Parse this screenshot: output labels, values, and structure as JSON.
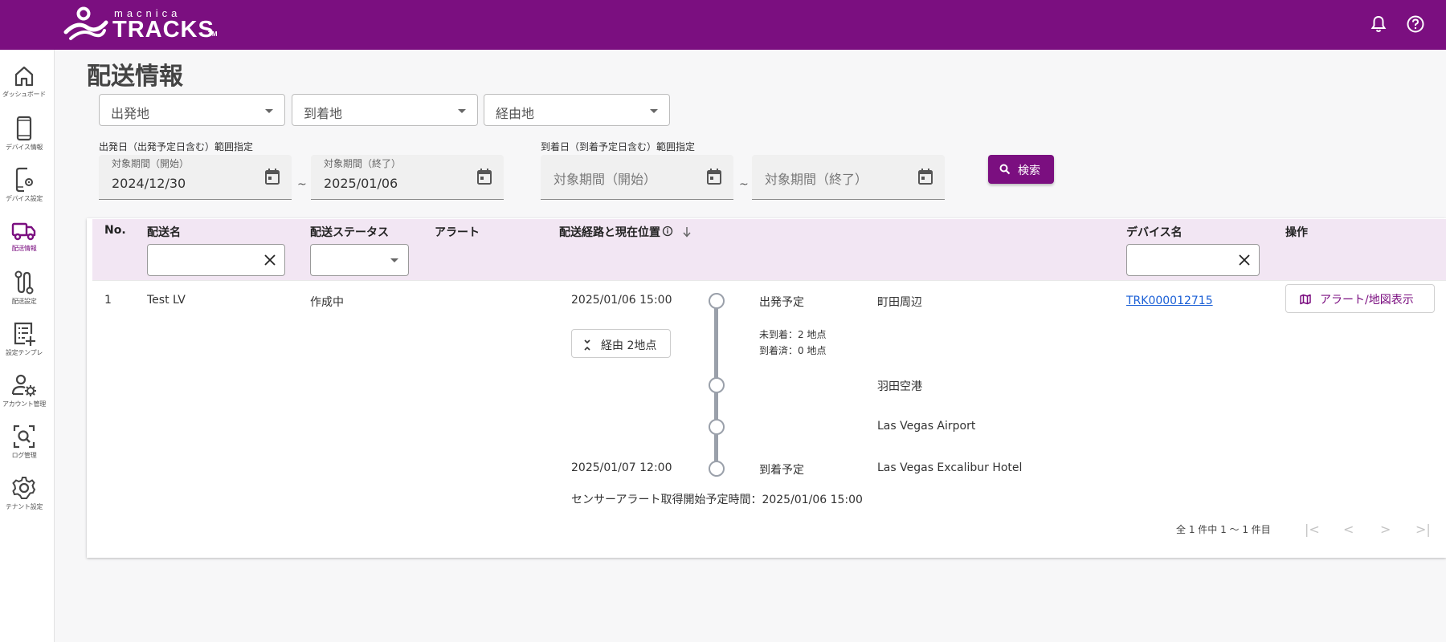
{
  "header": {
    "logo_small": "macnica",
    "logo_big": "TRACKS",
    "logo_tm": "TM",
    "bell_icon": "bell-icon",
    "help_icon": "help-circle-icon"
  },
  "sidebar": {
    "items": [
      {
        "label": "ダッシュボード",
        "icon": "home-icon"
      },
      {
        "label": "デバイス情報",
        "icon": "phone-icon"
      },
      {
        "label": "デバイス設定",
        "icon": "phone-settings-icon"
      },
      {
        "label": "配送情報",
        "icon": "truck-icon",
        "active": true
      },
      {
        "label": "配送設定",
        "icon": "route-icon"
      },
      {
        "label": "設定テンプレ",
        "icon": "template-icon"
      },
      {
        "label": "アカウント管理",
        "icon": "account-settings-icon"
      },
      {
        "label": "ログ管理",
        "icon": "log-search-icon"
      },
      {
        "label": "テナント設定",
        "icon": "gear-icon"
      }
    ]
  },
  "page": {
    "title": "配送情報"
  },
  "filters": {
    "origin_placeholder": "出発地",
    "destination_placeholder": "到着地",
    "via_placeholder": "経由地",
    "departure_range_label": "出発日（出発予定日含む）範囲指定",
    "arrival_range_label": "到着日（到着予定日含む）範囲指定",
    "start_label": "対象期間（開始）",
    "end_label": "対象期間（終了）",
    "departure_start_value": "2024/12/30",
    "departure_end_value": "2025/01/06",
    "arrival_start_placeholder": "対象期間（開始）",
    "arrival_end_placeholder": "対象期間（終了）",
    "tilde": "~",
    "search_label": "検索"
  },
  "table": {
    "headers": {
      "no": "No.",
      "name": "配送名",
      "status": "配送ステータス",
      "alert": "アラート",
      "route": "配送経路と現在位置",
      "device": "デバイス名",
      "action": "操作"
    },
    "rows": [
      {
        "no": "1",
        "name": "Test LV",
        "status": "作成中",
        "departure_time": "2025/01/06 15:00",
        "departure_status": "出発予定",
        "departure_place": "町田周辺",
        "via_button": "経由 2地点",
        "not_arrived": "未到着：2 地点",
        "arrived": "到着済：0 地点",
        "via_point_1": "羽田空港",
        "via_point_2": "Las Vegas Airport",
        "arrival_time": "2025/01/07 12:00",
        "arrival_status": "到着予定",
        "arrival_place": "Las Vegas Excalibur Hotel",
        "sensor_alert": "センサーアラート取得開始予定時間：2025/01/06 15:00",
        "device": "TRK000012715",
        "action_label": "アラート/地図表示"
      }
    ]
  },
  "pagination": {
    "summary": "全 1 件中 1 〜 1 件目",
    "first": "|<",
    "prev": "<",
    "next": ">",
    "last": ">|"
  },
  "colors": {
    "brand": "#7b0f80",
    "header_row": "#f2e6f3",
    "link": "#1a5fd6"
  }
}
